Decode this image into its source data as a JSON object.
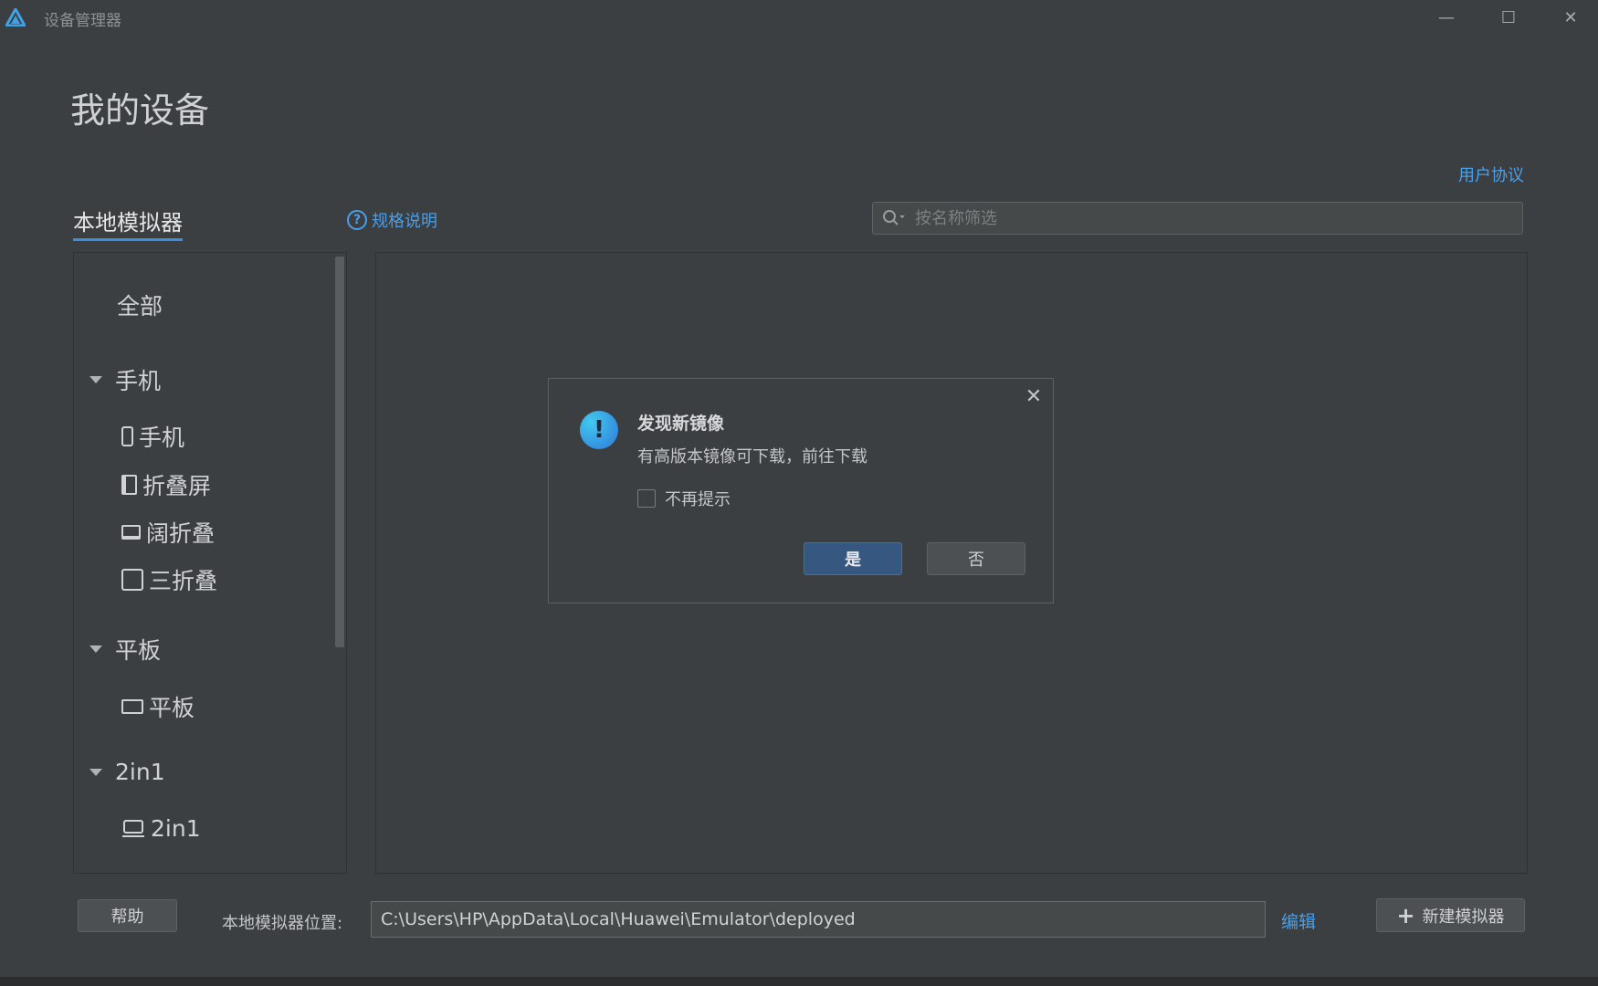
{
  "window": {
    "title": "设备管理器",
    "minimize": "—",
    "maximize": "☐",
    "close": "✕"
  },
  "header": {
    "page_title": "我的设备",
    "user_agreement": "用户协议"
  },
  "tabs": {
    "local_emulator": "本地模拟器",
    "spec_link": "规格说明",
    "help_glyph": "?"
  },
  "search": {
    "placeholder": "按名称筛选"
  },
  "sidebar": {
    "all": "全部",
    "groups": [
      {
        "label": "手机",
        "items": [
          {
            "label": "手机",
            "icon": "phone-icon"
          },
          {
            "label": "折叠屏",
            "icon": "foldable-icon"
          },
          {
            "label": "阔折叠",
            "icon": "wide-fold-icon"
          },
          {
            "label": "三折叠",
            "icon": "tri-fold-icon"
          }
        ]
      },
      {
        "label": "平板",
        "items": [
          {
            "label": "平板",
            "icon": "tablet-icon"
          }
        ]
      },
      {
        "label": "2in1",
        "items": [
          {
            "label": "2in1",
            "icon": "laptop-icon"
          }
        ]
      }
    ]
  },
  "dialog": {
    "title": "发现新镜像",
    "message": "有高版本镜像可下载，前往下载",
    "dont_remind": "不再提示",
    "yes": "是",
    "no": "否",
    "icon_glyph": "!",
    "close_glyph": "✕"
  },
  "footer": {
    "help": "帮助",
    "location_label": "本地模拟器位置:",
    "location_path": "C:\\Users\\HP\\AppData\\Local\\Huawei\\Emulator\\deployed",
    "edit": "编辑",
    "new_emulator": "新建模拟器",
    "plus_glyph": "+"
  },
  "colors": {
    "background": "#3c3f41",
    "accent_link": "#4a9fe8",
    "primary_button": "#365880"
  }
}
